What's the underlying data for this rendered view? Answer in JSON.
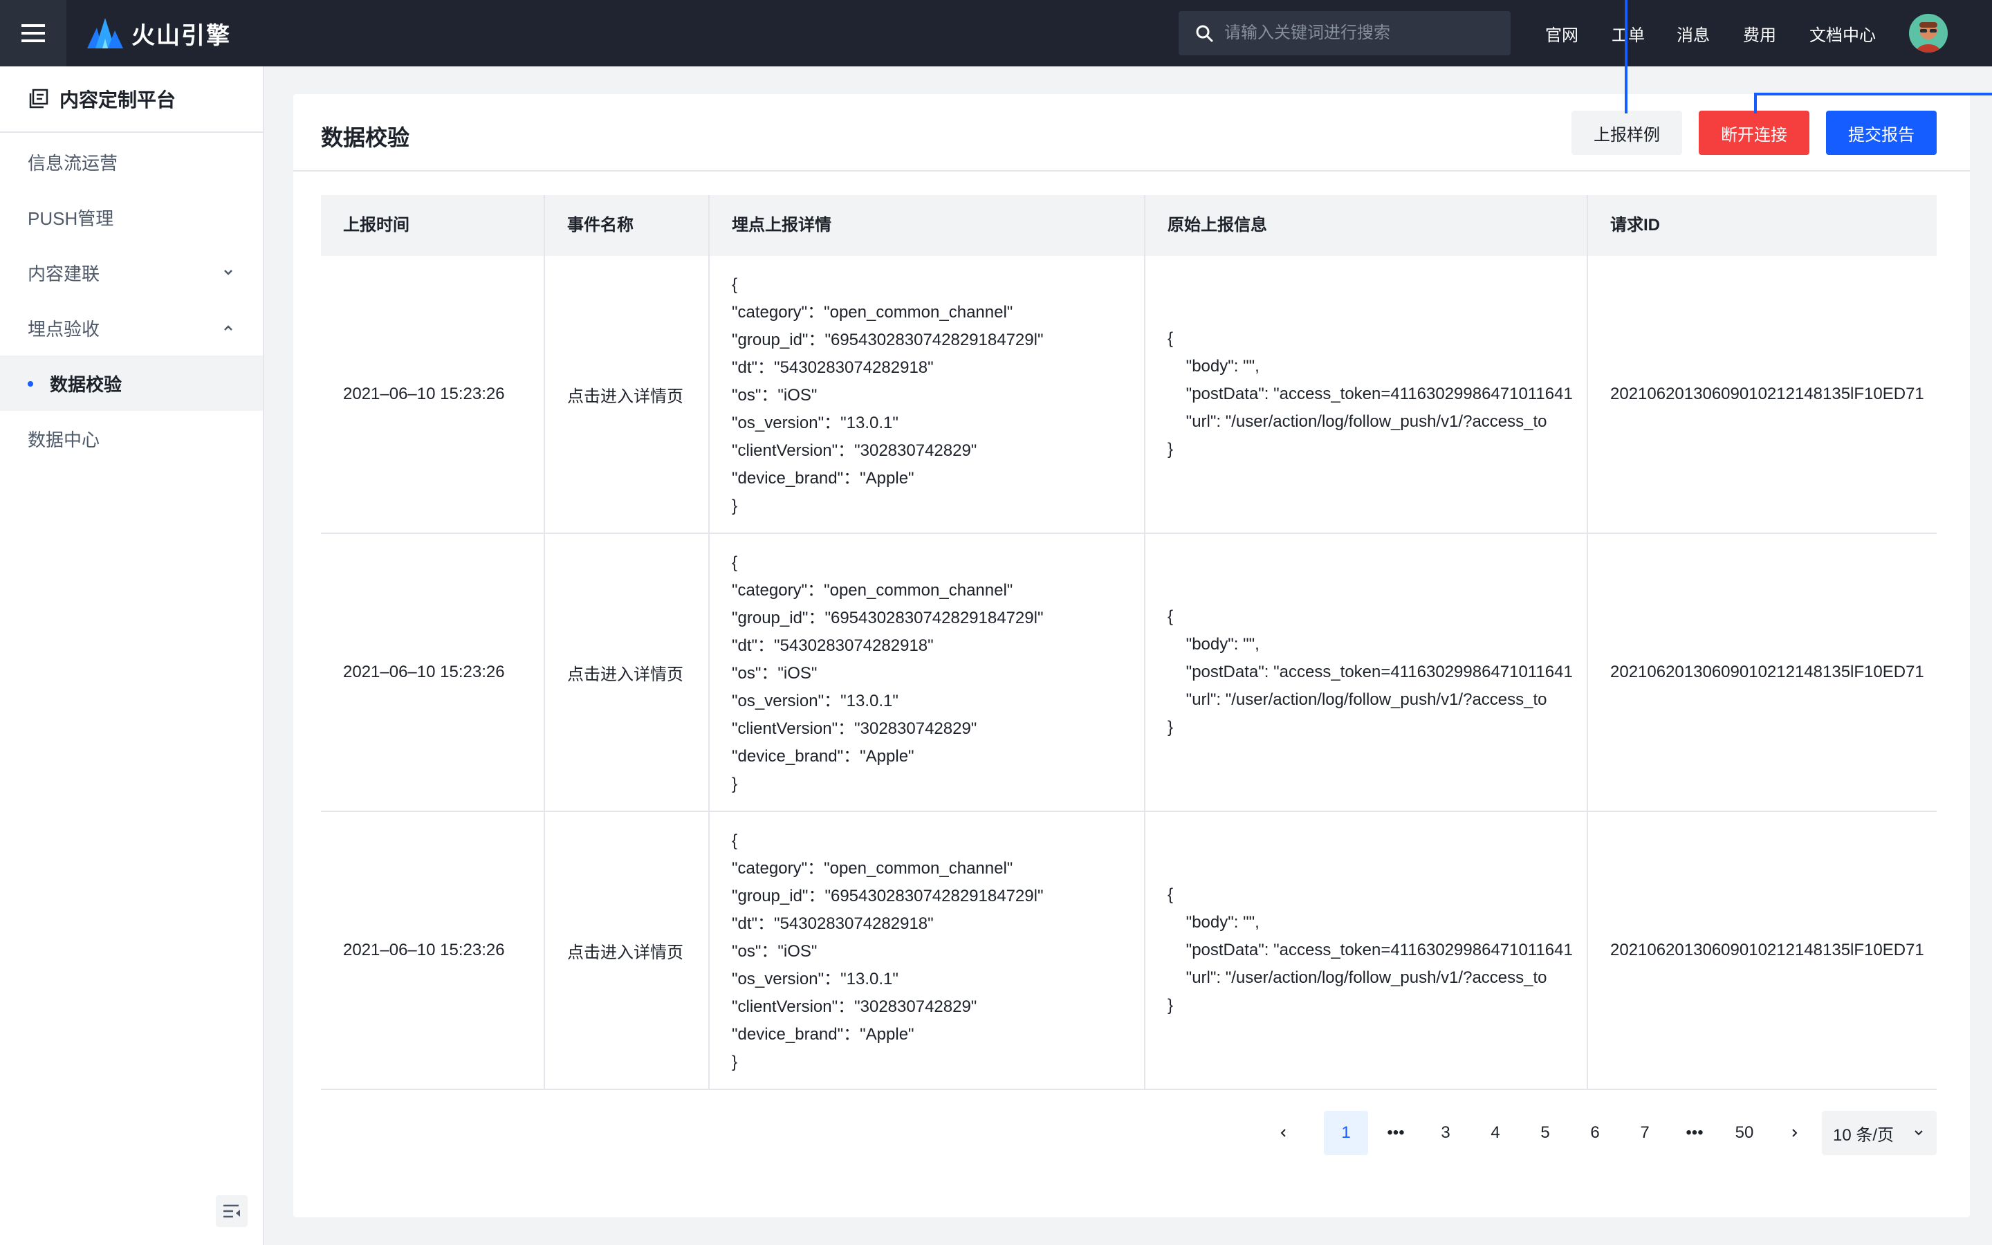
{
  "header": {
    "brand": "火山引擎",
    "search_placeholder": "请输入关键词进行搜索",
    "nav": [
      "官网",
      "工单",
      "消息",
      "费用",
      "文档中心"
    ]
  },
  "sidebar": {
    "title": "内容定制平台",
    "items": [
      {
        "label": "信息流运营"
      },
      {
        "label": "PUSH管理"
      },
      {
        "label": "内容建联",
        "chevron": "down"
      },
      {
        "label": "埋点验收",
        "chevron": "up"
      },
      {
        "label": "数据校验",
        "active": true
      },
      {
        "label": "数据中心"
      }
    ]
  },
  "main": {
    "title": "数据校验",
    "buttons": {
      "sample": "上报样例",
      "disconnect": "断开连接",
      "submit": "提交报告"
    },
    "columns": [
      "上报时间",
      "事件名称",
      "埋点上报详情",
      "原始上报信息",
      "请求ID"
    ],
    "rows": [
      {
        "time": "2021–06–10 15:23:26",
        "event": "点击进入详情页",
        "detail": [
          "{",
          "\"category\"：\"open_common_channel\"",
          "\"group_id\"：\"6954302830742829184729l\"",
          "\"dt\"：\"5430283074282918\"",
          "\"os\"：\"iOS\"",
          "\"os_version\"：\"13.0.1\"",
          "\"clientVersion\"：\"302830742829\"",
          "\"device_brand\"：\"Apple\"",
          "}"
        ],
        "raw": [
          "{",
          "    \"body\": \"\",",
          "    \"postData\": \"access_token=41163029986471011641",
          "    \"url\": \"/user/action/log/follow_push/v1/?access_to",
          "}"
        ],
        "request_id": "20210620130609010212148135lF10ED71"
      },
      {
        "time": "2021–06–10 15:23:26",
        "event": "点击进入详情页",
        "detail": [
          "{",
          "\"category\"：\"open_common_channel\"",
          "\"group_id\"：\"6954302830742829184729l\"",
          "\"dt\"：\"5430283074282918\"",
          "\"os\"：\"iOS\"",
          "\"os_version\"：\"13.0.1\"",
          "\"clientVersion\"：\"302830742829\"",
          "\"device_brand\"：\"Apple\"",
          "}"
        ],
        "raw": [
          "{",
          "    \"body\": \"\",",
          "    \"postData\": \"access_token=41163029986471011641",
          "    \"url\": \"/user/action/log/follow_push/v1/?access_to",
          "}"
        ],
        "request_id": "20210620130609010212148135lF10ED71"
      },
      {
        "time": "2021–06–10 15:23:26",
        "event": "点击进入详情页",
        "detail": [
          "{",
          "\"category\"：\"open_common_channel\"",
          "\"group_id\"：\"6954302830742829184729l\"",
          "\"dt\"：\"5430283074282918\"",
          "\"os\"：\"iOS\"",
          "\"os_version\"：\"13.0.1\"",
          "\"clientVersion\"：\"302830742829\"",
          "\"device_brand\"：\"Apple\"",
          "}"
        ],
        "raw": [
          "{",
          "    \"body\": \"\",",
          "    \"postData\": \"access_token=41163029986471011641",
          "    \"url\": \"/user/action/log/follow_push/v1/?access_to",
          "}"
        ],
        "request_id": "20210620130609010212148135lF10ED71"
      }
    ],
    "pagination": {
      "prev": "‹",
      "next": "›",
      "ellipsis": "•••",
      "pages": [
        "1",
        "3",
        "4",
        "5",
        "6",
        "7",
        "50"
      ],
      "current": "1",
      "page_size": "10 条/页"
    }
  },
  "colors": {
    "topbar": "#1f2430",
    "primary": "#165dff",
    "danger": "#f53f3f"
  },
  "icons": {
    "menu": "hamburger-icon",
    "search": "search-icon",
    "sidebar_title": "platform-icon",
    "collapse": "collapse-sidebar-icon"
  }
}
